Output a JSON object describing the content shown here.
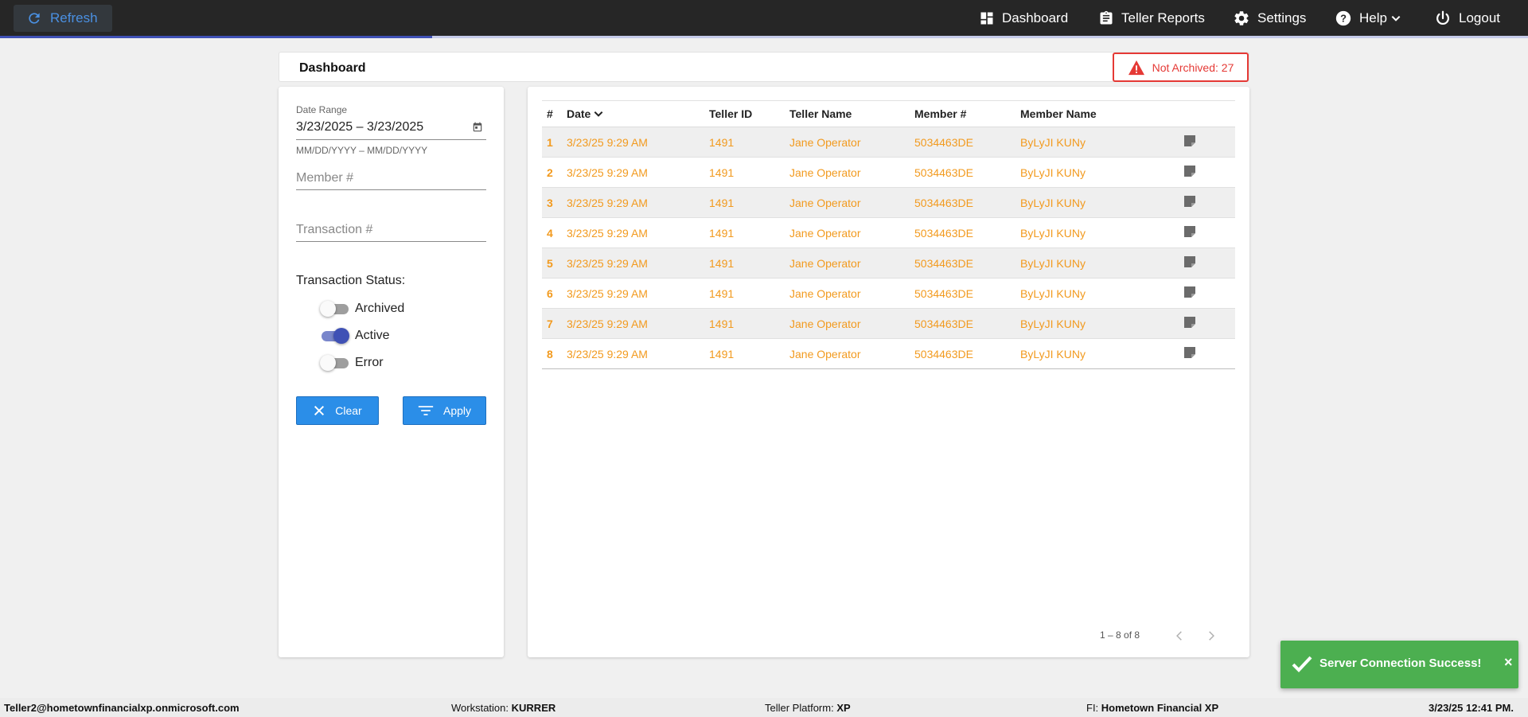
{
  "topbar": {
    "refresh_label": "Refresh",
    "progress_fraction": 0.283,
    "nav": {
      "dashboard": "Dashboard",
      "teller_reports": "Teller Reports",
      "settings": "Settings",
      "help": "Help",
      "logout": "Logout"
    }
  },
  "header": {
    "title": "Dashboard",
    "not_archived_label": "Not Archived: 27"
  },
  "filters": {
    "date_range_label": "Date Range",
    "date_range_value": "3/23/2025 – 3/23/2025",
    "date_hint": "MM/DD/YYYY – MM/DD/YYYY",
    "member_placeholder": "Member #",
    "transaction_placeholder": "Transaction #",
    "status_title": "Transaction Status:",
    "toggles": [
      {
        "label": "Archived",
        "on": false
      },
      {
        "label": "Active",
        "on": true
      },
      {
        "label": "Error",
        "on": false
      }
    ],
    "clear_label": "Clear",
    "apply_label": "Apply"
  },
  "table": {
    "columns": [
      "#",
      "Date",
      "Teller ID",
      "Teller Name",
      "Member #",
      "Member Name"
    ],
    "rows": [
      {
        "num": "1",
        "date": "3/23/25 9:29 AM",
        "teller_id": "1491",
        "teller_name": "Jane Operator",
        "member_num": "5034463DE",
        "member_name": "ByLyJI KUNy"
      },
      {
        "num": "2",
        "date": "3/23/25 9:29 AM",
        "teller_id": "1491",
        "teller_name": "Jane Operator",
        "member_num": "5034463DE",
        "member_name": "ByLyJI KUNy"
      },
      {
        "num": "3",
        "date": "3/23/25 9:29 AM",
        "teller_id": "1491",
        "teller_name": "Jane Operator",
        "member_num": "5034463DE",
        "member_name": "ByLyJI KUNy"
      },
      {
        "num": "4",
        "date": "3/23/25 9:29 AM",
        "teller_id": "1491",
        "teller_name": "Jane Operator",
        "member_num": "5034463DE",
        "member_name": "ByLyJI KUNy"
      },
      {
        "num": "5",
        "date": "3/23/25 9:29 AM",
        "teller_id": "1491",
        "teller_name": "Jane Operator",
        "member_num": "5034463DE",
        "member_name": "ByLyJI KUNy"
      },
      {
        "num": "6",
        "date": "3/23/25 9:29 AM",
        "teller_id": "1491",
        "teller_name": "Jane Operator",
        "member_num": "5034463DE",
        "member_name": "ByLyJI KUNy"
      },
      {
        "num": "7",
        "date": "3/23/25 9:29 AM",
        "teller_id": "1491",
        "teller_name": "Jane Operator",
        "member_num": "5034463DE",
        "member_name": "ByLyJI KUNy"
      },
      {
        "num": "8",
        "date": "3/23/25 9:29 AM",
        "teller_id": "1491",
        "teller_name": "Jane Operator",
        "member_num": "5034463DE",
        "member_name": "ByLyJI KUNy"
      }
    ],
    "paginator_range": "1 – 8 of 8"
  },
  "toast": {
    "message": "Server Connection Success!",
    "close_glyph": "×"
  },
  "footer": {
    "user": "Teller2@hometownfinancialxp.onmicrosoft.com",
    "workstation_label": "Workstation:",
    "workstation_value": "KURRER",
    "platform_label": "Teller Platform:",
    "platform_value": "XP",
    "fi_label": "FI:",
    "fi_value": "Hometown Financial XP",
    "datetime": "3/23/25 12:41 PM."
  },
  "colors": {
    "accent_blue": "#2b8ee8",
    "row_text_orange": "#f29a1e",
    "alert_red": "#e53935",
    "toggle_indigo": "#3f51b5",
    "toast_green": "#4caf50"
  },
  "icons": {
    "refresh": "refresh-icon",
    "dashboard": "dashboard-grid-icon",
    "reports": "clipboard-icon",
    "settings": "gear-icon",
    "help": "help-circle-icon",
    "logout": "power-icon",
    "alert": "warning-triangle-icon",
    "calendar": "calendar-icon",
    "note": "sticky-note-icon"
  }
}
